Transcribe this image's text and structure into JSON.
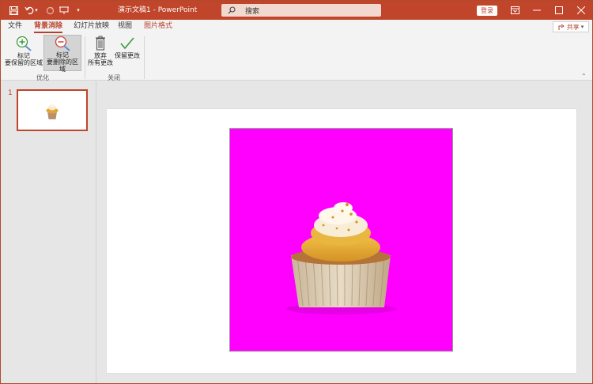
{
  "titlebar": {
    "doc_title": "演示文稿1  -  PowerPoint",
    "search_placeholder": "搜索",
    "login_label": "登录"
  },
  "menu": {
    "tabs": [
      {
        "label": "文件"
      },
      {
        "label": "背景消除"
      },
      {
        "label": "幻灯片放映"
      },
      {
        "label": "视图"
      },
      {
        "label": "图片格式"
      }
    ],
    "share_label": "共享"
  },
  "ribbon": {
    "mark_keep": {
      "line1": "标记",
      "line2": "要保留的区域"
    },
    "mark_remove": {
      "line1": "标记",
      "line2": "要删除的区域"
    },
    "group_refine": "优化",
    "discard": {
      "line1": "放弃",
      "line2": "所有更改"
    },
    "keep_changes": {
      "line1": "保留更改"
    },
    "group_close": "关闭"
  },
  "thumbnails": {
    "slide_number": "1"
  },
  "colors": {
    "accent": "#c0452a",
    "picture_background": "#ff00ff"
  }
}
